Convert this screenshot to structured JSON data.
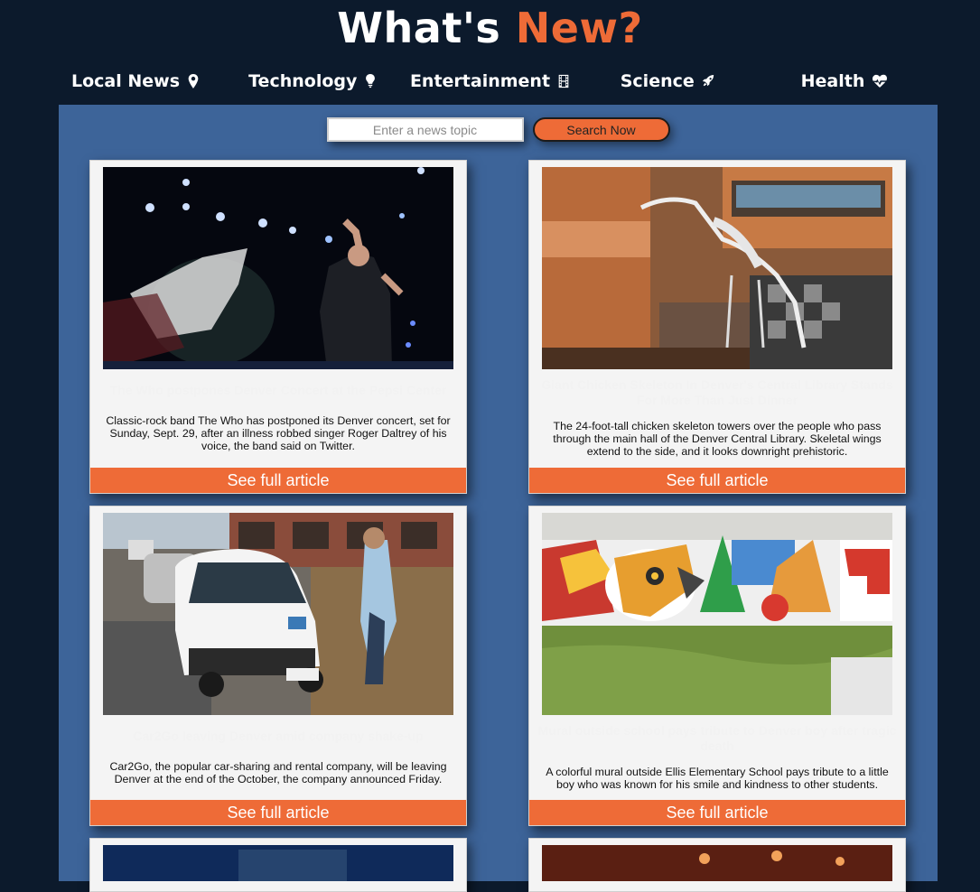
{
  "header": {
    "title_prefix": "What's",
    "title_accent": "New?"
  },
  "nav": [
    {
      "label": "Local News",
      "icon": "map-pin-icon"
    },
    {
      "label": "Technology",
      "icon": "lightbulb-icon"
    },
    {
      "label": "Entertainment",
      "icon": "film-icon"
    },
    {
      "label": "Science",
      "icon": "rocket-icon"
    },
    {
      "label": "Health",
      "icon": "heartbeat-icon"
    }
  ],
  "search": {
    "placeholder": "Enter a news topic",
    "button_label": "Search Now"
  },
  "colors": {
    "background": "#0c1a2c",
    "panel": "#3d6499",
    "accent": "#ee6b37"
  },
  "articles": [
    {
      "headline": "The Who postpones Denver Concert at the Pepsi Center",
      "description": "Classic-rock band The Who has postponed its Denver concert, set for Sunday, Sept. 29, after an illness robbed singer Roger Daltrey of his voice, the band said on Twitter.",
      "link_label": "See full article",
      "image": "concert-photo"
    },
    {
      "headline": "Giant Chicken Skeleton In Denver's Central Library Stands For More Than Just Dinner",
      "description": "The 24-foot-tall chicken skeleton towers over the people who pass through the main hall of the Denver Central Library. Skeletal wings extend to the side, and it looks downright prehistoric.",
      "link_label": "See full article",
      "image": "library-skeleton-photo"
    },
    {
      "headline": "Car2Go leaving Denver amid company shake-up",
      "description": "Car2Go, the popular car-sharing and rental company, will be leaving Denver at the end of the October, the company announced Friday.",
      "link_label": "See full article",
      "image": "car2go-photo"
    },
    {
      "headline": "Mural outside school pays tribute to Denver boy after tragic death",
      "description": "A colorful mural outside Ellis Elementary School pays tribute to a little boy who was known for his smile and kindness to other students.",
      "link_label": "See full article",
      "image": "mural-photo"
    }
  ]
}
